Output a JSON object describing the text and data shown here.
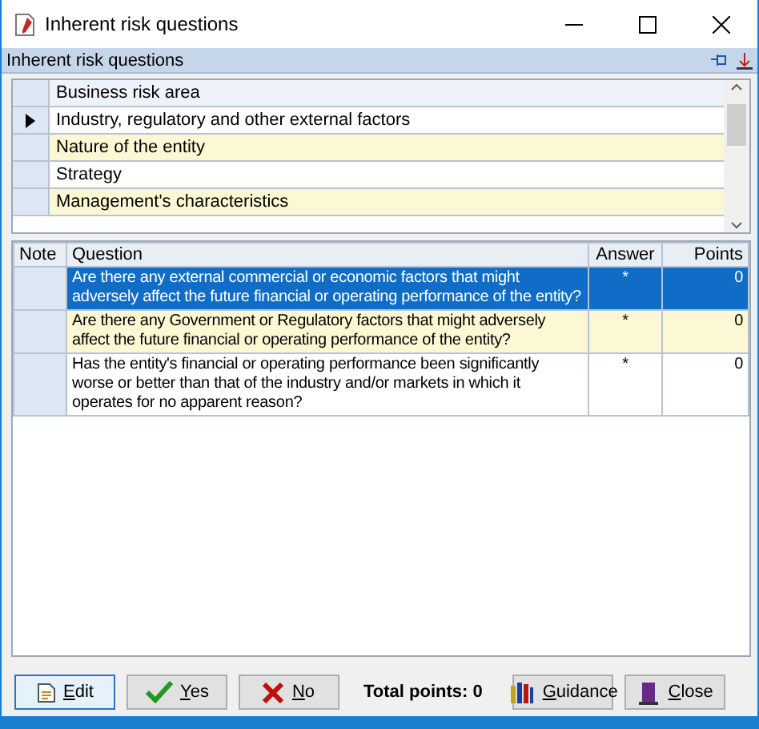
{
  "window": {
    "title": "Inherent risk questions"
  },
  "panel": {
    "title": "Inherent risk questions"
  },
  "areas": {
    "column": "Business risk area",
    "rows": [
      {
        "label": "Industry, regulatory and other external factors",
        "selected": true
      },
      {
        "label": "Nature of the entity",
        "selected": false
      },
      {
        "label": "Strategy",
        "selected": false
      },
      {
        "label": "Management's characteristics",
        "selected": false
      }
    ]
  },
  "questions": {
    "columns": [
      "Note",
      "Question",
      "Answer",
      "Points"
    ],
    "rows": [
      {
        "question": "Are there any external commercial or economic factors that might adversely affect the future financial or operating performance of the entity?",
        "answer": "*",
        "points": "0",
        "selected": true
      },
      {
        "question": "Are there any Government or Regulatory factors that might adversely affect the future financial or operating performance of the entity?",
        "answer": "*",
        "points": "0",
        "selected": false
      },
      {
        "question": "Has the entity's financial or operating performance been significantly worse or better than that of the industry and/or markets in which it operates for no apparent reason?",
        "answer": "*",
        "points": "0",
        "selected": false
      }
    ]
  },
  "buttons": [
    {
      "kind": "edit",
      "label": "Edit"
    },
    {
      "kind": "yes",
      "label": "Yes"
    },
    {
      "kind": "no",
      "label": "No"
    },
    {
      "kind": "total",
      "label": "Total points: 0"
    },
    {
      "kind": "guidance",
      "label": "Guidance"
    },
    {
      "kind": "close",
      "label": "Close"
    }
  ]
}
